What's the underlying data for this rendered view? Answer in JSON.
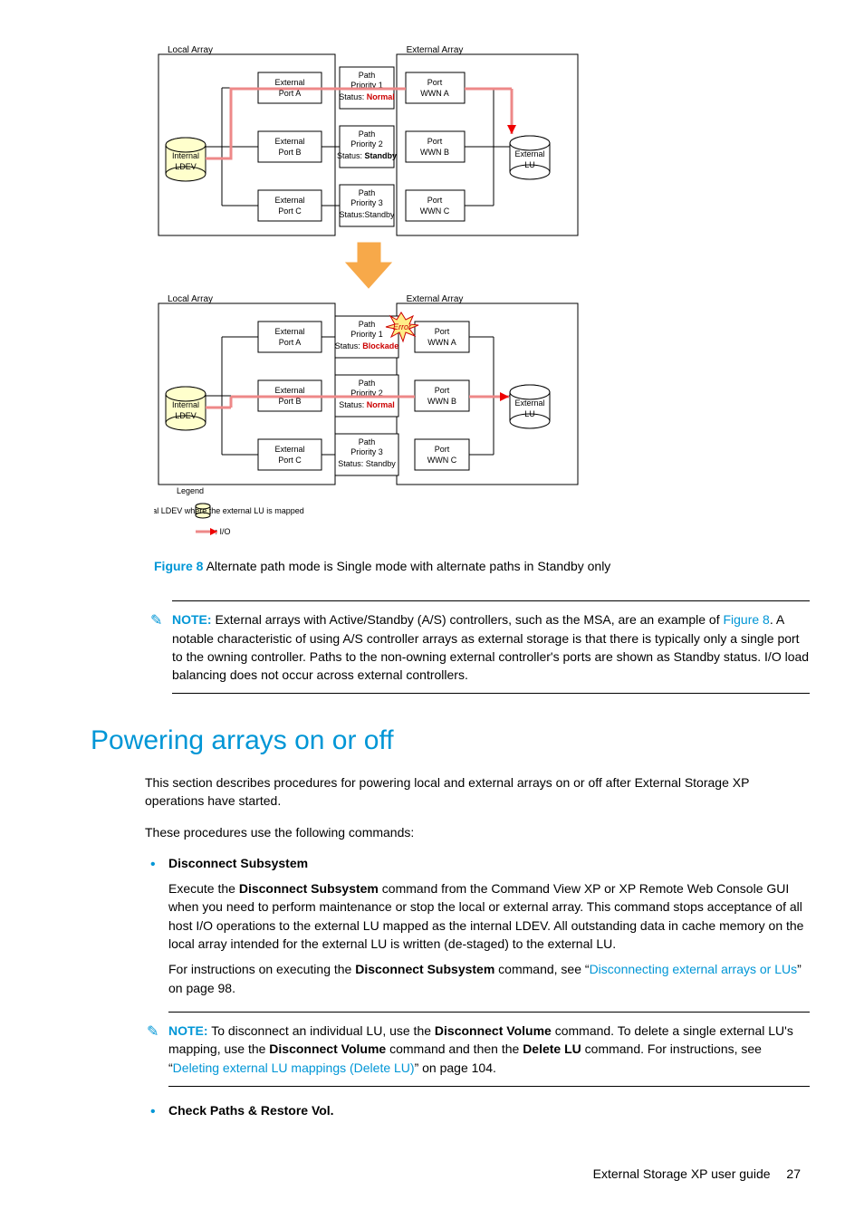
{
  "diagram": {
    "top": {
      "localArrayLabel": "Local Array",
      "externalArrayLabel": "External Array",
      "internalLdev": {
        "line1": "Internal",
        "line2": "LDEV"
      },
      "externalLu": {
        "line1": "External",
        "line2": "LU"
      },
      "rows": [
        {
          "port": {
            "l1": "External",
            "l2": "Port A"
          },
          "path": {
            "l1": "Path",
            "l2": "Priority 1",
            "l3pre": "Status: ",
            "l3status": "Normal",
            "statusClass": "status-normal"
          },
          "extPort": {
            "l1": "Port",
            "l2": "WWN A"
          }
        },
        {
          "port": {
            "l1": "External",
            "l2": "Port B"
          },
          "path": {
            "l1": "Path",
            "l2": "Priority 2",
            "l3pre": "Status: ",
            "l3status": "Standby",
            "statusClass": "status-standby"
          },
          "extPort": {
            "l1": "Port",
            "l2": "WWN B"
          }
        },
        {
          "port": {
            "l1": "External",
            "l2": "Port C"
          },
          "path": {
            "l1": "Path",
            "l2": "Priority 3",
            "l3pre": "Status:",
            "l3status": "Standby",
            "statusClass": ""
          },
          "extPort": {
            "l1": "Port",
            "l2": "WWN C"
          }
        }
      ]
    },
    "bottom": {
      "localArrayLabel": "Local Array",
      "externalArrayLabel": "External Array",
      "internalLdev": {
        "line1": "Internal",
        "line2": "LDEV"
      },
      "externalLu": {
        "line1": "External",
        "line2": "LU"
      },
      "errorLabel": "Error",
      "rows": [
        {
          "port": {
            "l1": "External",
            "l2": "Port A"
          },
          "path": {
            "l1": "Path",
            "l2": "Priority 1",
            "l3pre": "Status: ",
            "l3status": "Blockade",
            "statusClass": "status-blockade"
          },
          "extPort": {
            "l1": "Port",
            "l2": "WWN A"
          }
        },
        {
          "port": {
            "l1": "External",
            "l2": "Port B"
          },
          "path": {
            "l1": "Path",
            "l2": "Priority 2",
            "l3pre": "Status: ",
            "l3status": "Normal",
            "statusClass": "status-normal"
          },
          "extPort": {
            "l1": "Port",
            "l2": "WWN B"
          }
        },
        {
          "port": {
            "l1": "External",
            "l2": "Port C"
          },
          "path": {
            "l1": "Path",
            "l2": "Priority 3",
            "l3pre": "Status: ",
            "l3status": "Standby",
            "statusClass": ""
          },
          "extPort": {
            "l1": "Port",
            "l2": "WWN C"
          }
        }
      ]
    },
    "legend": {
      "title": "Legend",
      "ldev": ": Internal LDEV where the external LU is mapped",
      "io": ": I/O"
    }
  },
  "caption": {
    "label": "Figure 8",
    "text": " Alternate path mode is Single mode with alternate paths in Standby only"
  },
  "note1": {
    "label": "NOTE:",
    "textBefore": "   External arrays with Active/Standby (A/S) controllers, such as the MSA, are an example of ",
    "link": "Figure 8",
    "textAfter": ". A notable characteristic of using A/S controller arrays as external storage is that there is typically only a single port to the owning controller. Paths to the non-owning external controller's ports are shown as Standby status. I/O load balancing does not occur across external controllers."
  },
  "heading": "Powering arrays on or off",
  "intro1": "This section describes procedures for powering local and external arrays on or off after External Storage XP operations have started.",
  "intro2": "These procedures use the following commands:",
  "items": {
    "disconnect": {
      "title": "Disconnect Subsystem",
      "body1_pre": "Execute the ",
      "body1_bold": "Disconnect Subsystem",
      "body1_post": " command from the Command View XP or XP Remote Web Console GUI when you need to perform maintenance or stop the local or external array. This command stops acceptance of all host I/O operations to the external LU mapped as the internal LDEV. All outstanding data in cache memory on the local array intended for the external LU is written (de-staged) to the external LU.",
      "body2_pre": "For instructions on executing the ",
      "body2_bold": "Disconnect Subsystem",
      "body2_mid": " command, see “",
      "body2_link": "Disconnecting external arrays or LUs",
      "body2_post": "” on page 98."
    },
    "note2": {
      "label": "NOTE:",
      "t1": "   To disconnect an individual LU, use the ",
      "b1": "Disconnect Volume",
      "t2": " command. To delete a single external LU's mapping, use the ",
      "b2": "Disconnect Volume",
      "t3": " command and then the ",
      "b3": "Delete LU",
      "t4": " command. For instructions, see “",
      "link": "Deleting external LU mappings (Delete LU)",
      "t5": "” on page 104."
    },
    "check": {
      "title": "Check Paths & Restore Vol."
    }
  },
  "footer": {
    "title": "External Storage XP user guide",
    "page": "27"
  }
}
